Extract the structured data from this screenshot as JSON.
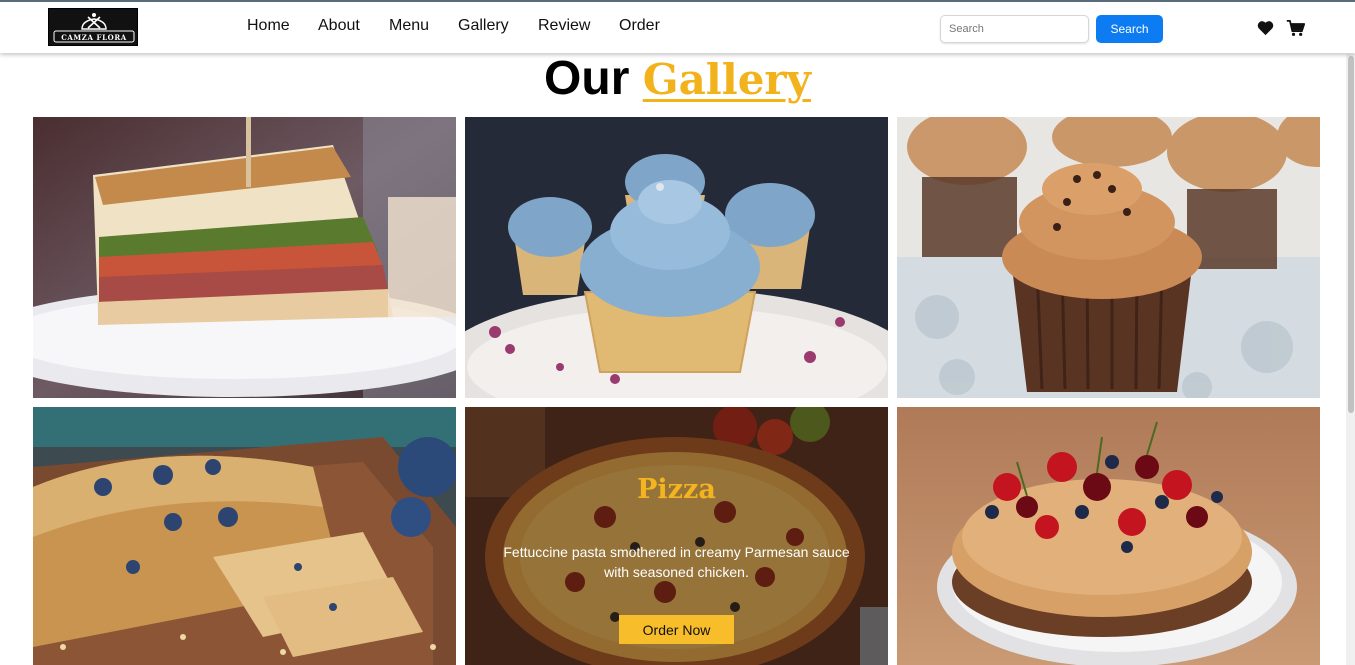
{
  "brand": {
    "name": "CAMZA FLORA"
  },
  "nav": {
    "links": [
      "Home",
      "About",
      "Menu",
      "Gallery",
      "Review",
      "Order"
    ]
  },
  "search": {
    "placeholder": "Search",
    "button_label": "Search"
  },
  "icons": {
    "wishlist": "heart-icon",
    "cart": "cart-icon"
  },
  "page": {
    "title_plain": "Our",
    "title_accent": "Gallery"
  },
  "gallery": {
    "items": [
      {
        "subject": "sandwich"
      },
      {
        "subject": "blue-frosted-cupcakes"
      },
      {
        "subject": "chocolate-cupcakes"
      },
      {
        "subject": "blueberry-oat-bread"
      },
      {
        "subject": "pizza",
        "title": "Pizza",
        "description": "Fettuccine pasta smothered in creamy Parmesan sauce with seasoned chicken.",
        "button_label": "Order Now"
      },
      {
        "subject": "berry-caramel-cake"
      }
    ]
  },
  "colors": {
    "accent": "#f2b21c",
    "button_primary": "#0d7bf2",
    "order_button": "#f7bd2a"
  }
}
